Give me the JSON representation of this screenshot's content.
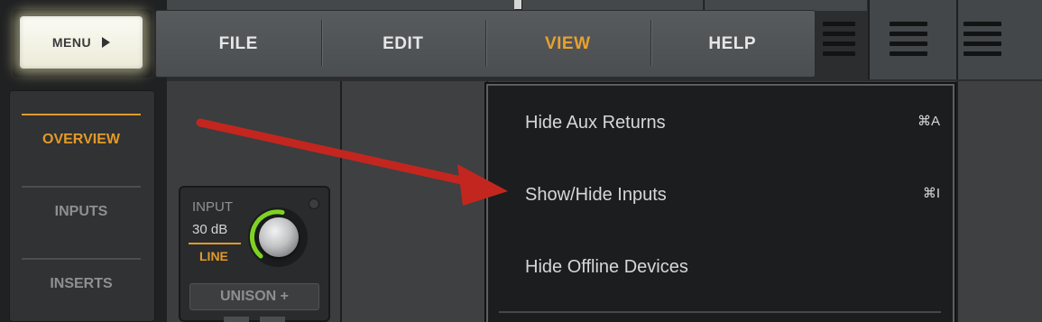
{
  "menu_button": {
    "label": "MENU",
    "icon": "play-arrow-icon"
  },
  "menu_bar": {
    "items": [
      {
        "label": "FILE",
        "active": false
      },
      {
        "label": "EDIT",
        "active": false
      },
      {
        "label": "VIEW",
        "active": true
      },
      {
        "label": "HELP",
        "active": false
      }
    ]
  },
  "toolbar_icons": [
    "hamburger-icon",
    "hamburger-icon",
    "hamburger-icon"
  ],
  "sidebar": {
    "items": [
      {
        "label": "OVERVIEW",
        "active": true
      },
      {
        "label": "INPUTS",
        "active": false
      },
      {
        "label": "INSERTS",
        "active": false
      }
    ]
  },
  "input_channel": {
    "label": "INPUT",
    "gain": "30 dB",
    "source": "LINE",
    "unison": "UNISON +"
  },
  "view_menu": {
    "items": [
      {
        "label": "Hide Aux Returns",
        "shortcut": "⌘A"
      },
      {
        "label": "Show/Hide Inputs",
        "shortcut": "⌘I"
      },
      {
        "label": "Hide Offline Devices",
        "shortcut": ""
      }
    ]
  },
  "colors": {
    "accent": "#e29a2a",
    "annotation_arrow": "#c3261f",
    "gain_ring": "#7ed321"
  }
}
